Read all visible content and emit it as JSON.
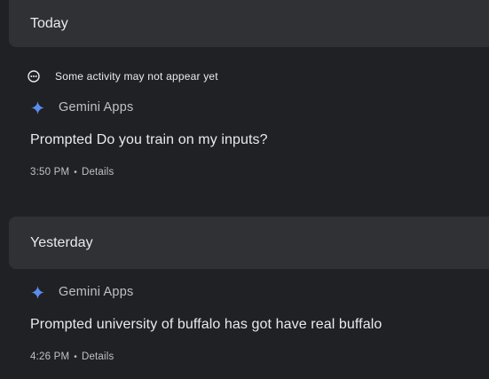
{
  "sections": [
    {
      "header": "Today",
      "notice": "Some activity may not appear yet",
      "entry": {
        "app": "Gemini Apps",
        "prompt": "Prompted Do you train on my inputs?",
        "time": "3:50 PM",
        "separator": "•",
        "details": "Details"
      }
    },
    {
      "header": "Yesterday",
      "entry": {
        "app": "Gemini Apps",
        "prompt": "Prompted university of buffalo has got have real buffalo",
        "time": "4:26 PM",
        "separator": "•",
        "details": "Details"
      }
    }
  ],
  "icons": {
    "notice": "more-horizontal-circle-icon",
    "app": "gemini-spark-icon"
  },
  "colors": {
    "background": "#202124",
    "header_bg": "#303134",
    "spark": "#5b8def"
  }
}
